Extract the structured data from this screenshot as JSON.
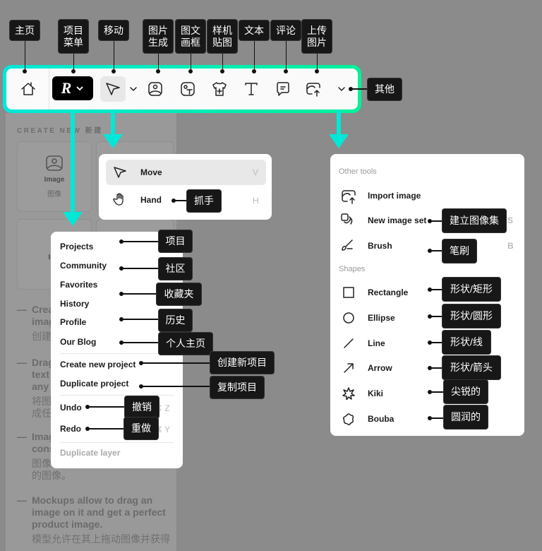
{
  "left_panel": {
    "section_title": "CREATE NEW 新建",
    "cards": [
      {
        "title": "Image",
        "subtitle": "图像"
      },
      {
        "title": "Ima",
        "subtitle": "图"
      }
    ],
    "features": [
      {
        "lines": "Crea\nimag",
        "zh": "创建"
      },
      {
        "lines": "Drag\ntext\nany",
        "zh": "将图\n成任"
      },
      {
        "lines": "Imag\ncons",
        "zh": "图像\n的图像。"
      },
      {
        "lines": "Mockups allow to drag an image on it and get a perfect product image.",
        "zh": "模型允许在其上拖动图像并获得"
      }
    ]
  },
  "toolbar": {
    "icons": [
      "home-icon",
      "logo-menu-button",
      "move-tool-button",
      "chevron-down-icon",
      "image-generate-icon",
      "text-frame-icon",
      "mockup-icon",
      "text-icon",
      "comment-icon",
      "upload-image-icon",
      "chevron-down-icon"
    ]
  },
  "move_menu": {
    "items": [
      {
        "label": "Move",
        "shortcut": "V"
      },
      {
        "label": "Hand",
        "shortcut": "H"
      }
    ]
  },
  "project_menu": {
    "items": [
      "Projects",
      "Community",
      "Favorites",
      "History",
      "Profile",
      "Our Blog",
      "Create new project",
      "Duplicate project"
    ],
    "undo": {
      "label": "Undo",
      "shortcut": "⌘ Z"
    },
    "redo": {
      "label": "Redo",
      "shortcut": "⌘ Y"
    },
    "disabled": "Duplicate layer"
  },
  "other_menu": {
    "header_tools": "Other tools",
    "header_shapes": "Shapes",
    "tools": [
      {
        "label": "Import image",
        "shortcut": ""
      },
      {
        "label": "New image set",
        "shortcut": "S"
      },
      {
        "label": "Brush",
        "shortcut": "B"
      }
    ],
    "shapes": [
      "Rectangle",
      "Ellipse",
      "Line",
      "Arrow",
      "Kiki",
      "Bouba"
    ]
  },
  "annotations": {
    "top": [
      "主页",
      "项目\n菜单",
      "移动",
      "图片\n生成",
      "图文\n画框",
      "样机\n贴图",
      "文本",
      "评论",
      "上传\n图片"
    ],
    "other": "其他",
    "hand": "抓手",
    "project": [
      "项目",
      "社区",
      "收藏夹",
      "历史",
      "个人主页",
      "创建新项目",
      "复制项目",
      "撤销",
      "重做"
    ],
    "tools": [
      "建立图像集",
      "笔刷",
      "形状/矩形",
      "形状/圆形",
      "形状/线",
      "形状/箭头",
      "尖锐的",
      "圆润的"
    ]
  },
  "colors": {
    "highlight": "#00e8d8",
    "label_bg": "#171717"
  }
}
